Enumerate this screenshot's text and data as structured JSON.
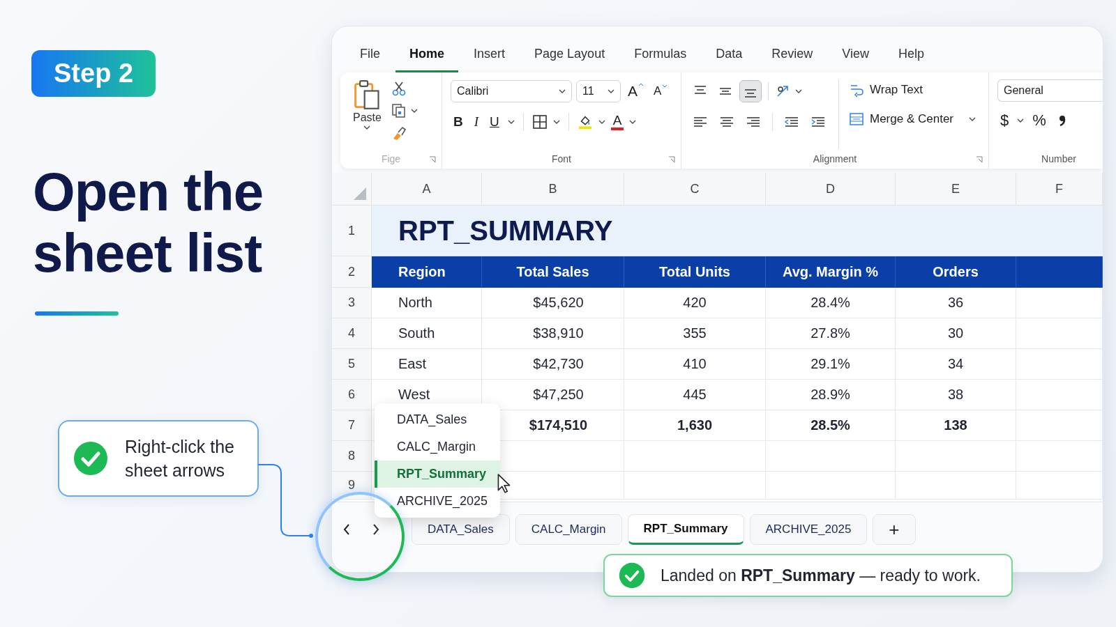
{
  "step_badge": "Step 2",
  "heading": "Open the sheet list",
  "callout": {
    "text": "Right-click the sheet arrows"
  },
  "menu_tabs": [
    {
      "label": "File",
      "selected": false
    },
    {
      "label": "Home",
      "selected": true
    },
    {
      "label": "Insert",
      "selected": false
    },
    {
      "label": "Page Layout",
      "selected": false
    },
    {
      "label": "Formulas",
      "selected": false
    },
    {
      "label": "Data",
      "selected": false
    },
    {
      "label": "Review",
      "selected": false
    },
    {
      "label": "View",
      "selected": false
    },
    {
      "label": "Help",
      "selected": false
    }
  ],
  "ribbon": {
    "clipboard": {
      "paste_label": "Paste",
      "group_label": "Fige"
    },
    "font": {
      "name": "Calibri",
      "size": "11",
      "grow": "A",
      "shrink": "A",
      "bold": "B",
      "italic": "I",
      "underline": "U",
      "font_color": "A",
      "group_label": "Font"
    },
    "alignment": {
      "vertical": [
        {
          "selected": false
        },
        {
          "selected": false
        },
        {
          "selected": true
        }
      ],
      "wrap_text": "Wrap Text",
      "merge": "Merge & Center",
      "group_label": "Alignment"
    },
    "number": {
      "format": "General",
      "currency": "$",
      "percent": "%",
      "group_label": "Number"
    }
  },
  "grid": {
    "columns": [
      "A",
      "B",
      "C",
      "D",
      "E",
      "F"
    ],
    "title_row": {
      "row": "1",
      "text": "RPT_SUMMARY"
    },
    "header_row": {
      "row": "2",
      "cells": [
        "Region",
        "Total Sales",
        "Total Units",
        "Avg. Margin %",
        "Orders"
      ]
    },
    "rows": [
      {
        "row": "3",
        "kind": "data",
        "region": "North",
        "values": [
          "$45,620",
          "420",
          "28.4%",
          "36"
        ]
      },
      {
        "row": "4",
        "kind": "data",
        "region": "South",
        "values": [
          "$38,910",
          "355",
          "27.8%",
          "30"
        ]
      },
      {
        "row": "5",
        "kind": "data",
        "region": "East",
        "values": [
          "$42,730",
          "410",
          "29.1%",
          "34"
        ]
      },
      {
        "row": "6",
        "kind": "data",
        "region": "West",
        "values": [
          "$47,250",
          "445",
          "28.9%",
          "38"
        ]
      },
      {
        "row": "7",
        "kind": "total",
        "values": [
          "$174,510",
          "1,630",
          "28.5%",
          "138"
        ]
      }
    ],
    "empty_rows": [
      "8",
      "9"
    ]
  },
  "sheet_menu": [
    {
      "label": "DATA_Sales",
      "selected": false
    },
    {
      "label": "CALC_Margin",
      "selected": false
    },
    {
      "label": "RPT_Summary",
      "selected": true
    },
    {
      "label": "ARCHIVE_2025",
      "selected": false
    }
  ],
  "sheet_tabs": [
    {
      "label": "DATA_Sales",
      "selected": false
    },
    {
      "label": "CALC_Margin",
      "selected": false
    },
    {
      "label": "RPT_Summary",
      "selected": true
    },
    {
      "label": "ARCHIVE_2025",
      "selected": false
    }
  ],
  "add_sheet": "+",
  "toast": {
    "text": "Landed on **RPT_Summary** — ready to work."
  }
}
